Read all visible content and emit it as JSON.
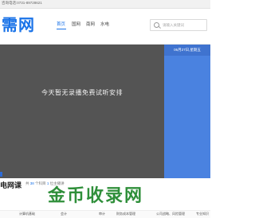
{
  "topbar": {
    "hotline": "咨询电话:0731-89728621"
  },
  "header": {
    "logo": "需网",
    "nav": [
      "首页",
      "国网",
      "南网",
      "水电"
    ],
    "search_placeholder": "请输入关键词"
  },
  "hero": {
    "caption": "今天暂无录播免费试听安排",
    "date": "06月27日,星期五"
  },
  "section": {
    "title": "电网课",
    "stats_prefix": "共",
    "course_count": "38",
    "stats_mid": "个科目",
    "student_count": "1",
    "stats_suffix": "位主播讲"
  },
  "watermark": "金币收录网",
  "categories": [
    "计算机基础",
    "会计",
    "审计",
    "财务成本管理",
    "公司战略、风险管理",
    "专业知识"
  ],
  "colors": {
    "accent": "#1a73e8",
    "hero_bg": "#545454",
    "panel": "#4a82e0"
  }
}
